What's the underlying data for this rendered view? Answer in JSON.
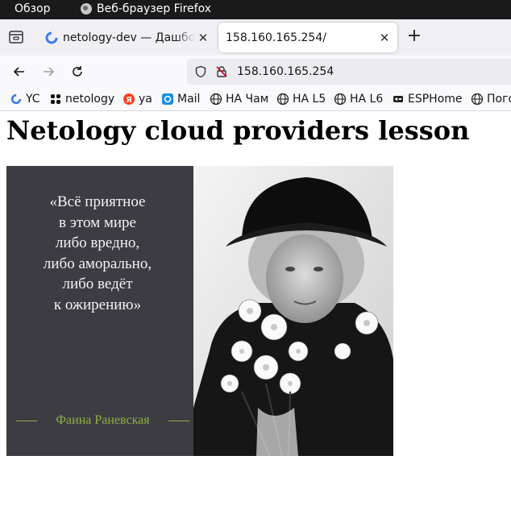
{
  "topbar": {
    "overview": "Обзор",
    "app_name": "Веб-браузер Firefox"
  },
  "tabs": [
    {
      "title": "netology-dev — Дашборд",
      "active": false
    },
    {
      "title": "158.160.165.254/",
      "active": true
    }
  ],
  "url": "158.160.165.254",
  "bookmarks": [
    {
      "label": "YC",
      "icon": "yc-icon"
    },
    {
      "label": "netology",
      "icon": "netology-icon"
    },
    {
      "label": "ya",
      "icon": "yandex-icon"
    },
    {
      "label": "Mail",
      "icon": "mail-icon"
    },
    {
      "label": "HA Чам",
      "icon": "globe-icon"
    },
    {
      "label": "HA L5",
      "icon": "globe-icon"
    },
    {
      "label": "HA L6",
      "icon": "globe-icon"
    },
    {
      "label": "ESPHome",
      "icon": "esphome-icon"
    },
    {
      "label": "Погода",
      "icon": "globe-icon"
    }
  ],
  "page": {
    "heading": "Netology cloud providers lesson",
    "quote_lines": [
      "«Всё приятное",
      "в этом мире",
      "либо вредно,",
      "либо аморально,",
      "либо ведёт",
      "к ожирению»"
    ],
    "quote_author": "Фаина Раневская"
  },
  "colors": {
    "quote_panel": "#3d3c42",
    "author_accent": "#8fb04a",
    "topbar": "#1a1a1a"
  }
}
